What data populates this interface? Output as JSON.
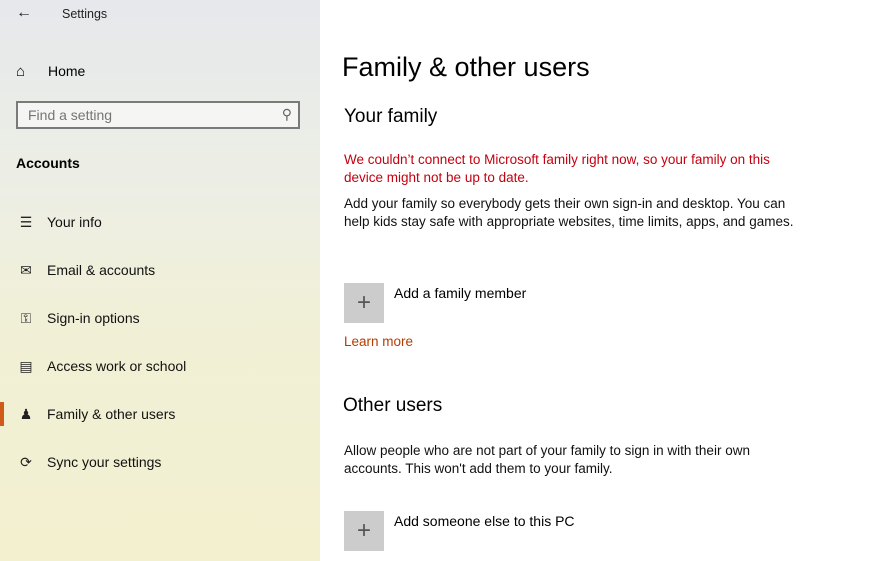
{
  "app": {
    "title": "Settings",
    "back_icon": "arrow-left-icon"
  },
  "sidebar": {
    "home_label": "Home",
    "search": {
      "placeholder": "Find a setting"
    },
    "section_title": "Accounts",
    "items": [
      {
        "label": "Your info",
        "icon": "person-card-icon",
        "selected": false
      },
      {
        "label": "Email & accounts",
        "icon": "mail-icon",
        "selected": false
      },
      {
        "label": "Sign-in options",
        "icon": "key-icon",
        "selected": false
      },
      {
        "label": "Access work or school",
        "icon": "briefcase-icon",
        "selected": false
      },
      {
        "label": "Family & other users",
        "icon": "person-add-icon",
        "selected": true
      },
      {
        "label": "Sync your settings",
        "icon": "sync-icon",
        "selected": false
      }
    ],
    "accent_color": "#d05a1a"
  },
  "main": {
    "title": "Family & other users",
    "family": {
      "heading": "Your family",
      "warning": "We couldn’t connect to Microsoft family right now, so your family on this device might not be up to date.",
      "description": "Add your family so everybody gets their own sign-in and desktop. You can help kids stay safe with appropriate websites, time limits, apps, and games.",
      "add_label": "Add a family member",
      "learn_more": "Learn more"
    },
    "other": {
      "heading": "Other users",
      "description": "Allow people who are not part of your family to sign in with their own accounts. This won't add them to your family.",
      "add_label": "Add someone else to this PC"
    },
    "warning_color": "#c5000f",
    "link_color": "#b33c00"
  }
}
